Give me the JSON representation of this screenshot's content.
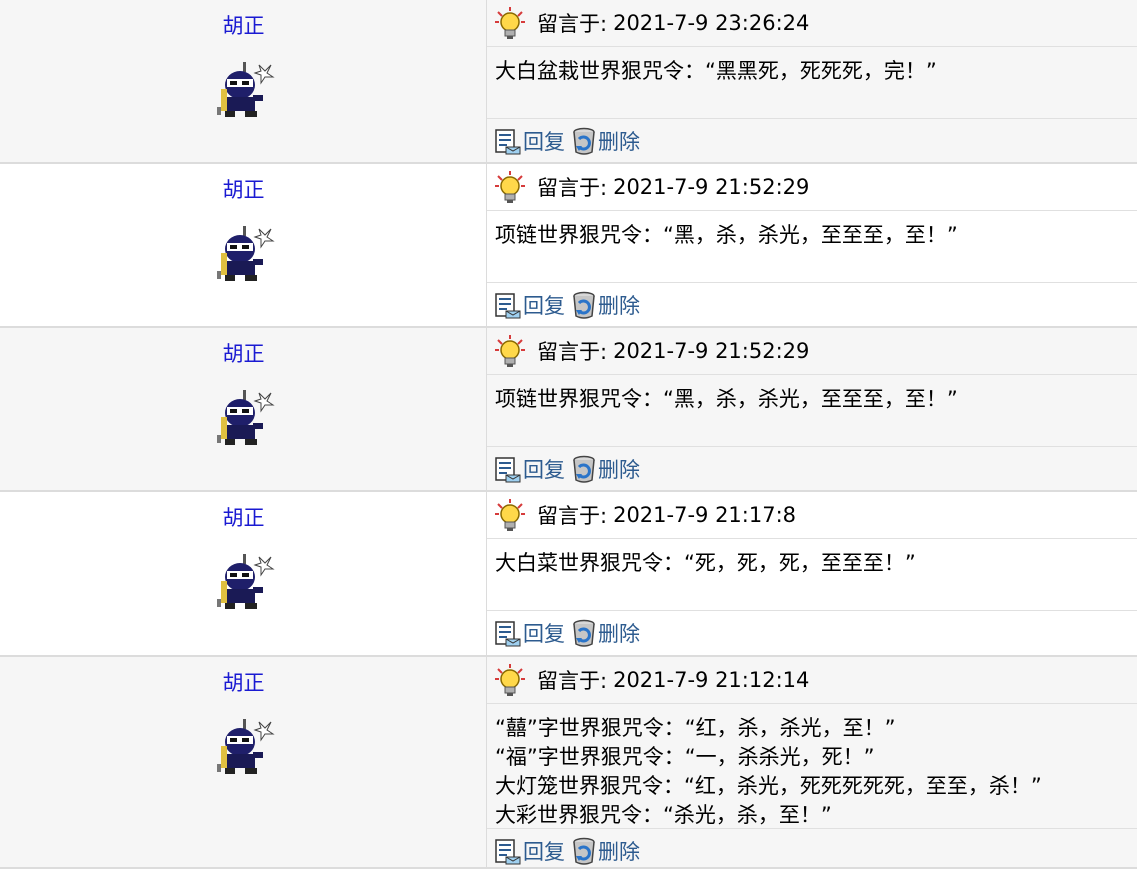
{
  "messages": [
    {
      "author": "胡正",
      "label": "留言于:",
      "time": "2021-7-9 23:26:24",
      "content": "大白盆栽世界狠咒令：“黑黑死，死死死，完！”",
      "reply": "回复",
      "delete": "删除"
    },
    {
      "author": "胡正",
      "label": "留言于:",
      "time": "2021-7-9 21:52:29",
      "content": "项链世界狠咒令：“黑，杀，杀光，至至至，至！”",
      "reply": "回复",
      "delete": "删除"
    },
    {
      "author": "胡正",
      "label": "留言于:",
      "time": "2021-7-9 21:52:29",
      "content": "项链世界狠咒令：“黑，杀，杀光，至至至，至！”",
      "reply": "回复",
      "delete": "删除"
    },
    {
      "author": "胡正",
      "label": "留言于:",
      "time": "2021-7-9 21:17:8",
      "content": "大白菜世界狠咒令：“死，死，死，至至至！”",
      "reply": "回复",
      "delete": "删除"
    },
    {
      "author": "胡正",
      "label": "留言于:",
      "time": "2021-7-9 21:12:14",
      "content": "“囍”字世界狠咒令：“红，杀，杀光，至！”\n“福”字世界狠咒令：“一，杀杀光，死！”\n大灯笼世界狠咒令：“红，杀光，死死死死死，至至，杀！”\n大彩世界狠咒令：“杀光，杀，至！”",
      "reply": "回复",
      "delete": "删除"
    }
  ],
  "icons": {
    "avatar": "ninja-avatar-icon",
    "header": "lightbulb-icon",
    "reply": "reply-edit-icon",
    "delete": "trash-can-icon"
  }
}
